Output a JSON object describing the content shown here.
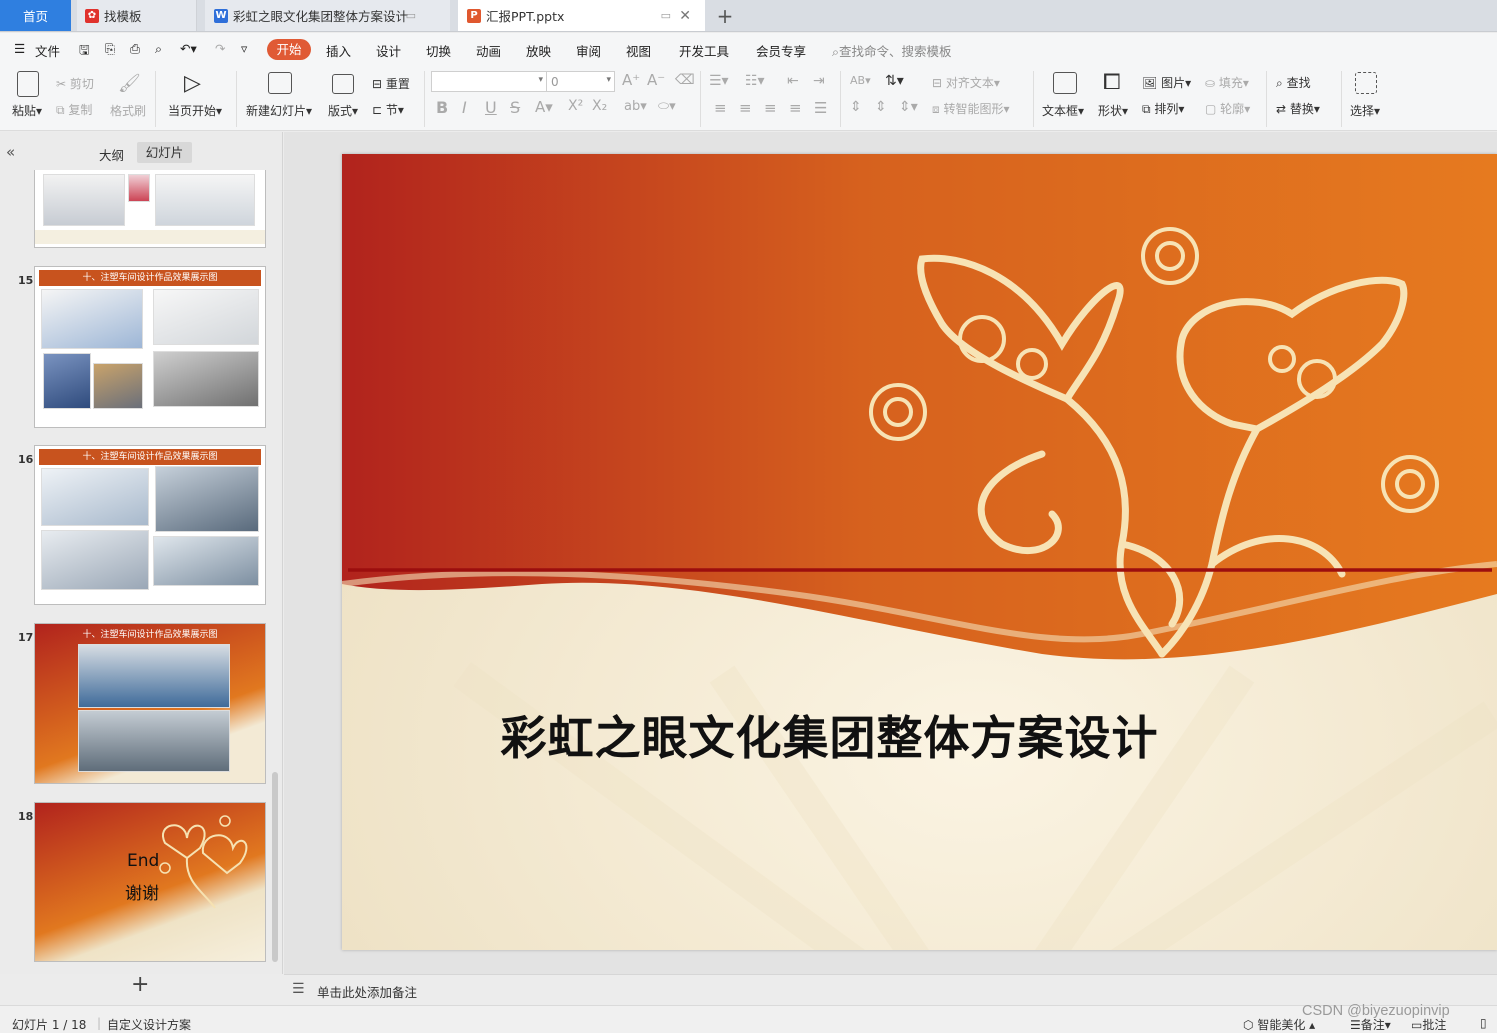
{
  "tabs": {
    "home": "首页",
    "template": "找模板",
    "doc": "彩虹之眼文化集团整体方案设计",
    "ppt": "汇报PPT.pptx",
    "new_tab": "+"
  },
  "menu": {
    "file": "文件",
    "items": [
      "开始",
      "插入",
      "设计",
      "切换",
      "动画",
      "放映",
      "审阅",
      "视图",
      "开发工具",
      "会员专享"
    ],
    "search_placeholder": "查找命令、搜索模板"
  },
  "ribbon": {
    "paste": "粘贴",
    "cut": "剪切",
    "copy": "复制",
    "format_painter": "格式刷",
    "from_current": "当页开始",
    "new_slide": "新建幻灯片",
    "layout": "版式",
    "reset": "重置",
    "section": "节",
    "font_size": "0",
    "align_text": "对齐文本",
    "smartart": "转智能图形",
    "textbox": "文本框",
    "shape": "形状",
    "picture": "图片",
    "arrange": "排列",
    "fill": "填充",
    "outline": "轮廓",
    "find": "查找",
    "replace": "替换",
    "select": "选择"
  },
  "panel": {
    "outline_tab": "大纲",
    "slides_tab": "幻灯片",
    "add_slide": "+",
    "thumbnails": [
      {
        "num": "15",
        "title": "十、注塑车间设计作品效果展示图"
      },
      {
        "num": "16",
        "title": "十、注塑车间设计作品效果展示图"
      },
      {
        "num": "17",
        "title": "十、注塑车间设计作品效果展示图"
      },
      {
        "num": "18",
        "line1": "End",
        "line2": "谢谢"
      }
    ]
  },
  "slide": {
    "title": "彩虹之眼文化集团整体方案设计"
  },
  "notes": {
    "placeholder": "单击此处添加备注"
  },
  "status": {
    "slide_info": "幻灯片 1 / 18",
    "theme": "自定义设计方案",
    "beautify": "智能美化",
    "notes": "备注",
    "comments": "批注"
  },
  "watermark": "CSDN @biyezuopinvip",
  "colors": {
    "accent": "#e05a35",
    "home_tab": "#2f7fe0",
    "slide_red": "#b1231d",
    "slide_orange": "#e1781f",
    "slide_cream": "#f3ead5"
  }
}
